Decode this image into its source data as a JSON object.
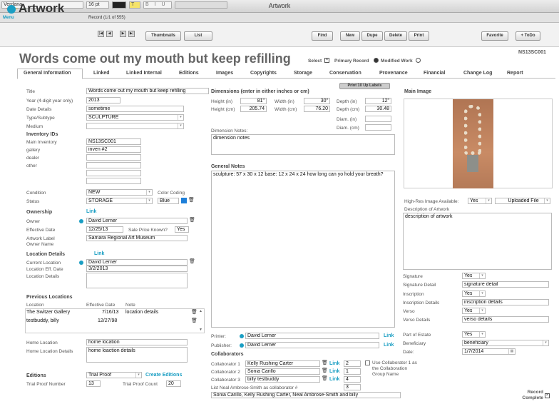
{
  "window": {
    "title": "Artwork"
  },
  "format": {
    "font": "Verdana",
    "size": "16 pt",
    "style_buttons": "B I U"
  },
  "header": {
    "app_title": "Artwork",
    "menu": "Menu",
    "record_info": "Record (1/1 of 555)",
    "thumbnails": "Thumbnails",
    "list": "List",
    "find": "Find",
    "new": "New",
    "dupe": "Dupe",
    "delete": "Delete",
    "print": "Print",
    "favorite": "Favorite",
    "todo": "+ ToDo"
  },
  "record": {
    "title": "Words come out my mouth but keep refilling",
    "select_label": "Select",
    "primary_label": "Primary Record",
    "modified_label": "Modified Work",
    "id": "NS13SC001"
  },
  "tabs": [
    "General Information",
    "Linked",
    "Linked Internal",
    "Editions",
    "Images",
    "Copyrights",
    "Storage",
    "Conservation",
    "Provenance",
    "Financial",
    "Change Log",
    "Report"
  ],
  "print_labels": "Print 10 Up Labels",
  "left": {
    "title_label": "Title",
    "title": "Words come out my mouth but keep refilling",
    "year_label": "Year (4-digit year only)",
    "year": "2013",
    "date_label": "Date Details",
    "date": "sometime",
    "type_label": "Type/Subtype",
    "type": "SCULPTURE",
    "medium_label": "Medium",
    "inv_head": "Inventory IDs",
    "main_inv_label": "Main Inventory",
    "main_inv": "NS13SC001",
    "gallery_label": "gallery",
    "gallery": "inven #2",
    "dealer_label": "dealer",
    "other_label": "other",
    "cond_label": "Condition",
    "cond": "NEW",
    "color_label": "Color Coding",
    "color": "Blue",
    "status_label": "Status",
    "status": "STORAGE",
    "own_head": "Ownership",
    "own_link": "Link",
    "owner_label": "Owner",
    "owner": "David Lerner",
    "eff_label": "Effective Date",
    "eff": "12/25/13",
    "sale_label": "Sale Price Known?",
    "sale": "Yes",
    "art_label_l1": "Artwork Label",
    "art_label_l2": "Owner Name",
    "art_label": "Samara Regional Art Museum",
    "loc_head": "Location Details",
    "loc_link": "Link",
    "cur_loc_label": "Current Location",
    "cur_loc": "David Lerner",
    "loc_eff_label": "Location Eff. Date",
    "loc_eff": "3/2/2013",
    "loc_det_label": "Location Details",
    "prev_head": "Previous Locations",
    "prev_cols": [
      "Location",
      "Effective Date",
      "Note"
    ],
    "prev_rows": [
      {
        "loc": "The Switzer Gallery",
        "date": "7/16/13",
        "note": "location details"
      },
      {
        "loc": "testbuddy, billy",
        "date": "12/27/98",
        "note": ""
      }
    ],
    "home_label": "Home Location",
    "home": "home location",
    "home_det_label": "Home Location Details",
    "home_det": "home loaction details",
    "ed_head": "Editions",
    "ed": "Trial Proof",
    "ed_link": "Create Editions",
    "tp_num_label": "Trial Proof Number",
    "tp_num": "13",
    "tp_count_label": "Trial Proof Count",
    "tp_count": "20"
  },
  "mid": {
    "dim_head": "Dimensions (enter in either inches or cm)",
    "h_in_label": "Height (in)",
    "h_in": "81\"",
    "w_in_label": "Width (in)",
    "w_in": "30\"",
    "d_in_label": "Depth (in)",
    "d_in": "12\"",
    "h_cm_label": "Height (cm)",
    "h_cm": "205.74",
    "w_cm_label": "Width (cm)",
    "w_cm": "76.20",
    "d_cm_label": "Depth (cm)",
    "d_cm": "30.48",
    "diam_in_label": "Diam. (in)",
    "diam_cm_label": "Diam. (cm)",
    "dim_notes_label": "Dimension Notes:",
    "dim_notes": "dimension notes",
    "gen_notes_label": "General Notes",
    "gen_notes": "sculpture: 57 x 30 x 12 base: 12 x 24 x 24 how long can yo hold your breath?",
    "printer_label": "Printer:",
    "printer": "David Lerner",
    "pub_label": "Publisher:",
    "publisher": "David Lerner",
    "link": "Link",
    "collab_head": "Collaborators",
    "collabs": [
      {
        "label": "Collaborator 1",
        "name": "Kelly Rushing Carter",
        "num": "2"
      },
      {
        "label": "Collaborator 2",
        "name": "Sonia Carillo",
        "num": "1"
      },
      {
        "label": "Collaborator 3",
        "name": "billy testbuddy",
        "num": "4"
      }
    ],
    "use_collab": "Use Collaborator 1 as the Collaboration Group Name",
    "list_label": "List Neal Ambrose-Smith as collaborator #",
    "list_num": "3",
    "collab_list": "Sonia Carillo, Kelly Rushing Carter, Neal Ambrose-Smith and billy"
  },
  "right": {
    "main_image": "Main Image",
    "hires_label": "High-Res Image Available:",
    "hires": "Yes",
    "uploaded": "Uploaded File",
    "desc_label": "Description of Artwork",
    "desc": "description of artwork",
    "sig_label": "Signature",
    "sig": "Yes",
    "sig_det_label": "Signature Detail",
    "sig_det": "signature detail",
    "insc_label": "Inscription",
    "insc": "Yes",
    "insc_det_label": "Inscription Details",
    "insc_det": "inscription details",
    "verso_label": "Verso",
    "verso": "Yes",
    "verso_det_label": "Verso Details",
    "verso_det": "verso details",
    "estate_label": "Part of Estate",
    "estate": "Yes",
    "benef_label": "Beneficiary",
    "benef": "beneficiary",
    "date_label": "Date:",
    "date": "1/7/2014",
    "rec_complete": "Record Complete"
  }
}
